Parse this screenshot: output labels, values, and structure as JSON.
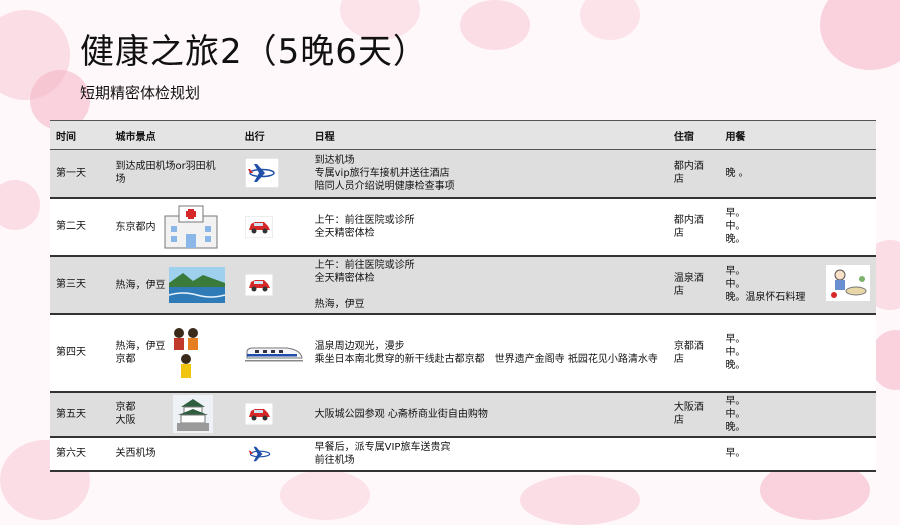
{
  "title": "健康之旅2（5晚6天）",
  "subtitle": "短期精密体检规划",
  "table": {
    "headers": {
      "time": "时间",
      "city": "城市景点",
      "transport": "出行",
      "schedule": "日程",
      "hotel": "住宿",
      "meals": "用餐"
    },
    "rows": [
      {
        "day": "第一天",
        "city": "到达成田机场or羽田机场",
        "transport_icon": "airplane-icon",
        "schedule": "到达机场\n专属vip旅行车接机并送往酒店\n陪同人员介绍说明健康检查事项",
        "hotel": "都内酒店",
        "meals": "晚 。"
      },
      {
        "day": "第二天",
        "city": "东京都内",
        "transport_icon": "car-icon",
        "schedule": "上午：前往医院或诊所\n全天精密体检",
        "hotel": "都内酒店",
        "meals": "早。\n中。\n晚。"
      },
      {
        "day": "第三天",
        "city": "热海，伊豆",
        "transport_icon": "car-icon",
        "schedule": "上午：前往医院或诊所\n全天精密体检\n\n热海，伊豆",
        "hotel": "温泉酒店",
        "meals": "早。\n中。\n晚。温泉怀石料理"
      },
      {
        "day": "第四天",
        "city": "热海，伊豆\n京都",
        "transport_icon": "bullet-train-icon",
        "schedule": "温泉周边观光，漫步\n乘坐日本南北贯穿的新干线赴古都京都　世界遗产金阁寺  祇园花见小路清水寺",
        "hotel": "京都酒店",
        "meals": "早。\n中。\n晚。"
      },
      {
        "day": "第五天",
        "city": "京都\n大阪",
        "transport_icon": "car-icon",
        "schedule": "大阪城公园参观  心斋桥商业街自由购物",
        "hotel": "大阪酒店",
        "meals": "早。\n中。\n晚。"
      },
      {
        "day": "第六天",
        "city": "关西机场",
        "transport_icon": "airplane-icon",
        "schedule": "早餐后，派专属VIP旅车送贵宾\n前往机场",
        "hotel": "",
        "meals": "早。"
      }
    ]
  },
  "colors": {
    "blossom": "#f4b6c6",
    "header_bg": "#e4e4e4",
    "shade_row": "#dedede",
    "car": "#d62828",
    "train_stripe": "#1f4fa8"
  }
}
